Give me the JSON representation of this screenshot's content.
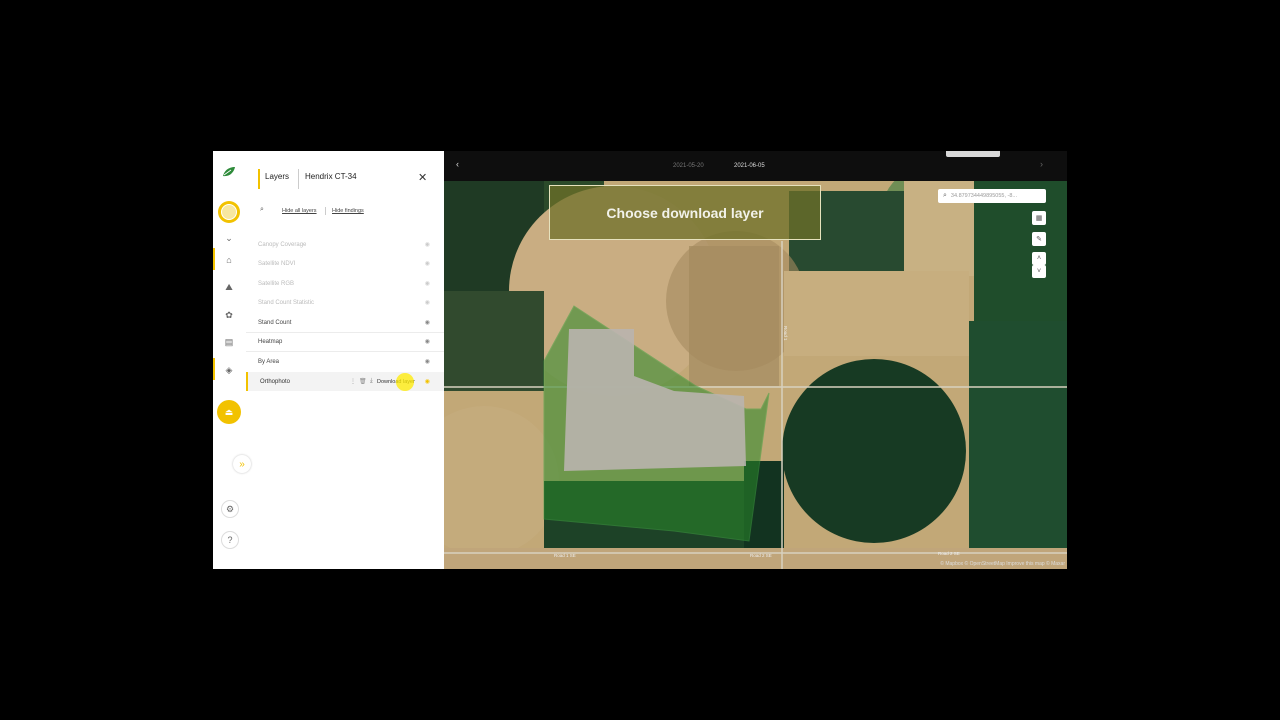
{
  "panel": {
    "tabs": [
      "Layers",
      "Hendrix CT-34"
    ],
    "actions": [
      "Hide all layers",
      "Hide findings"
    ],
    "layers": [
      {
        "label": "Canopy Coverage",
        "faded": true
      },
      {
        "label": "Satellite NDVI",
        "faded": true
      },
      {
        "label": "Satellite RGB",
        "faded": true
      },
      {
        "label": "Stand Count Statistic",
        "faded": true
      },
      {
        "label": "Stand Count",
        "faded": false
      },
      {
        "label": "Heatmap",
        "faded": false
      },
      {
        "label": "By Area",
        "faded": false
      },
      {
        "label": "Orthophoto",
        "faded": false,
        "selected": true
      }
    ],
    "download_label": "Download layer"
  },
  "map": {
    "dates": [
      "2021-05-20",
      "2021-06-05"
    ],
    "banner": "Choose download layer",
    "search_value": "34.879734449895055, -8...",
    "attribution": "© Mapbox © OpenStreetMap Improve this map © Maxar",
    "road_labels": [
      "Road 1 SE",
      "Road 2 SE",
      "Road 2 SE",
      "Road 1"
    ]
  },
  "colors": {
    "accent": "#f2c200",
    "brand_green": "#2e8b3a",
    "selection_overlay": "#2a8a2a"
  },
  "icons": [
    "logo-leaf-icon",
    "avatar-icon",
    "chevron-down-icon",
    "home-icon",
    "map-icon",
    "plant-icon",
    "document-icon",
    "layers-icon",
    "upload-icon",
    "expand-icon",
    "settings-icon",
    "help-icon",
    "close-icon",
    "search-icon",
    "eye-icon",
    "trash-icon",
    "download-icon",
    "more-icon",
    "map-type-icon",
    "ruler-icon",
    "zoom-in-icon",
    "zoom-out-icon",
    "arrow-left-icon",
    "arrow-right-icon"
  ]
}
